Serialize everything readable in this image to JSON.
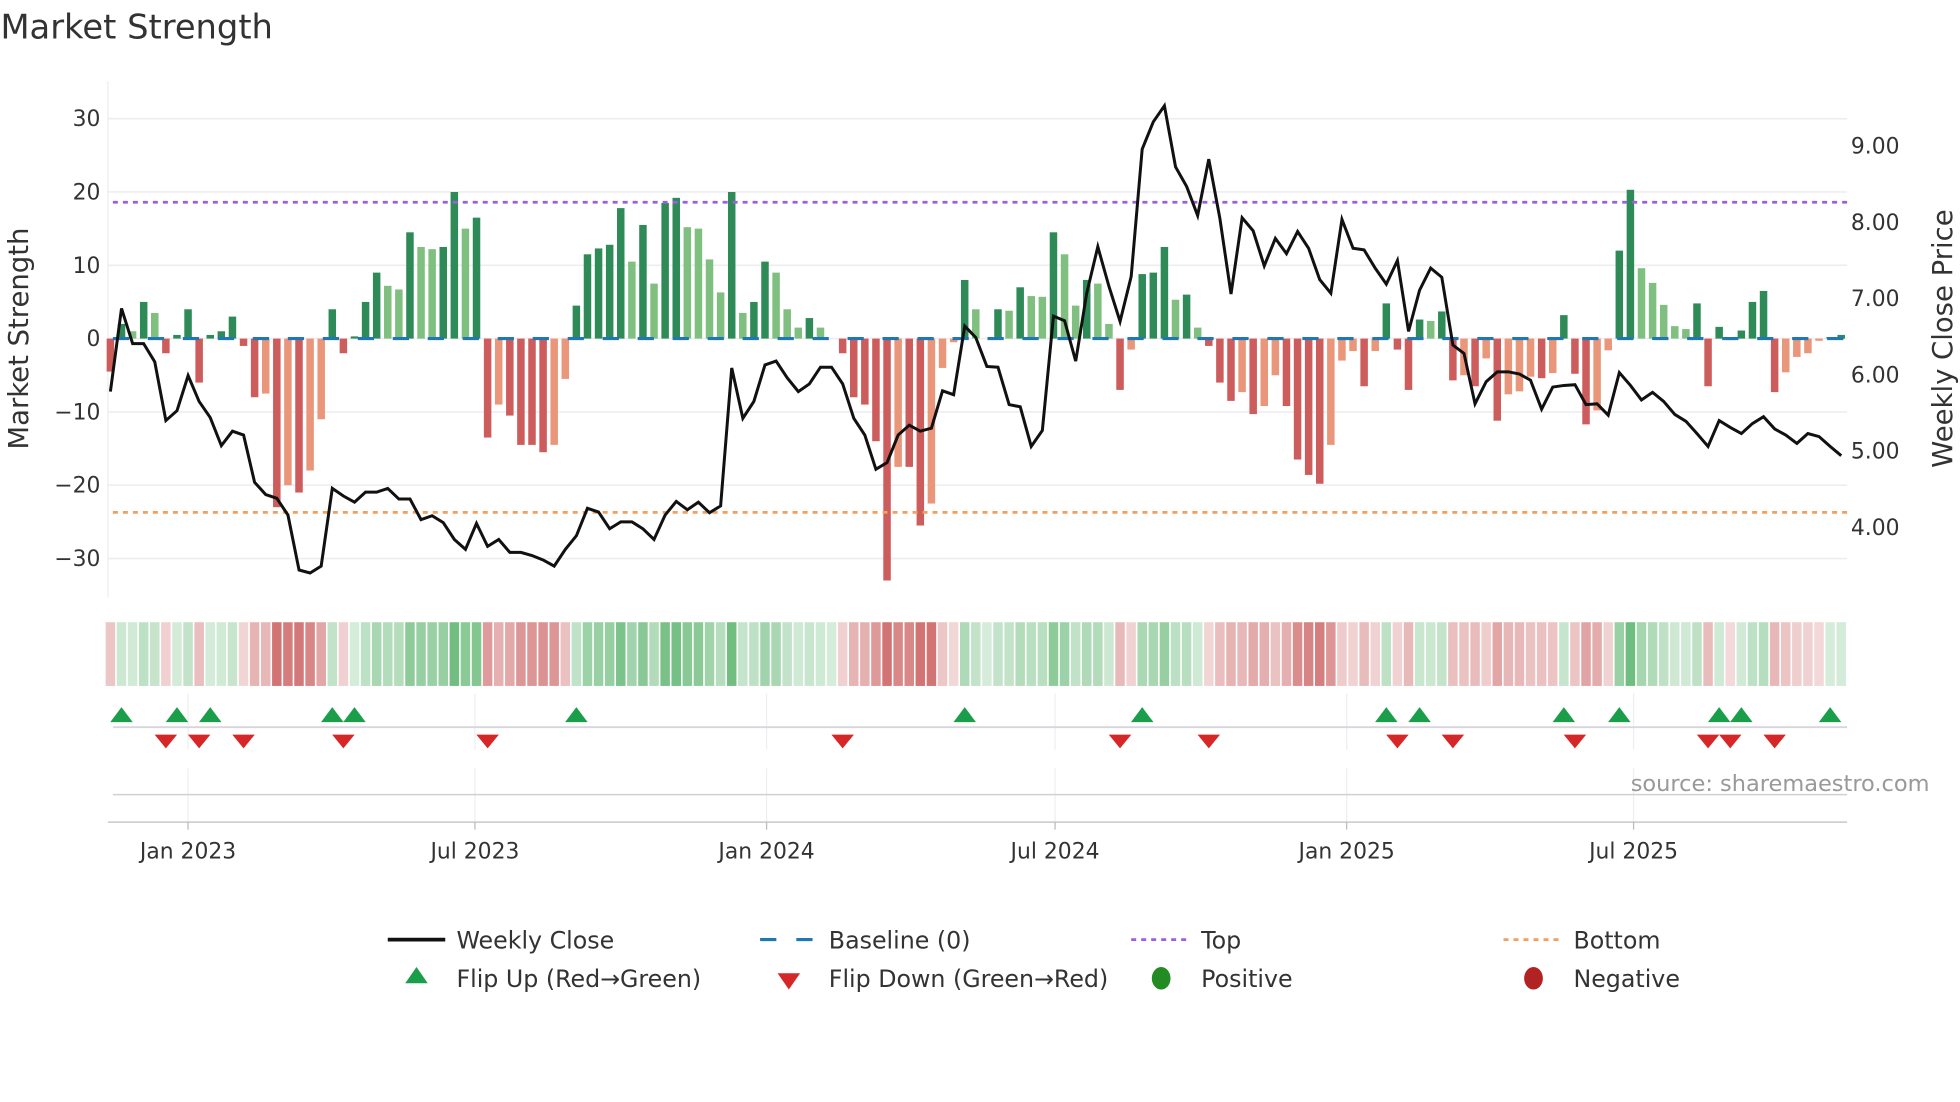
{
  "chart_data": {
    "type": "bar",
    "title": "Market Strength",
    "ylabel": "Market Strength",
    "ylabel_right": "Weekly Close Price",
    "ylim": [
      -35,
      35
    ],
    "ylim_right": [
      3.15,
      9.95
    ],
    "yticks": [
      "30",
      "20",
      "10",
      "0",
      "−10",
      "−20",
      "−30"
    ],
    "ytick_values": [
      30,
      20,
      10,
      0,
      -10,
      -20,
      -30
    ],
    "yticks_right": [
      "9.00",
      "8.00",
      "7.00",
      "6.00",
      "5.00",
      "4.00"
    ],
    "ytick_right_values": [
      9,
      8,
      7,
      6,
      5,
      4
    ],
    "x_start_date": "2022-11-13",
    "x_interval_days": 7,
    "xticks": [
      {
        "date": "2023-01-01",
        "label": "Jan 2023"
      },
      {
        "date": "2023-07-01",
        "label": "Jul 2023"
      },
      {
        "date": "2024-01-01",
        "label": "Jan 2024"
      },
      {
        "date": "2024-07-01",
        "label": "Jul 2024"
      },
      {
        "date": "2025-01-01",
        "label": "Jan 2025"
      },
      {
        "date": "2025-07-01",
        "label": "Jul 2025"
      }
    ],
    "grid": true,
    "top_level": 18.6,
    "bottom_level": -23.7,
    "baseline": 0,
    "strength": [
      -4.5,
      2,
      1,
      5,
      3.5,
      -2,
      0.5,
      4,
      -6,
      0.5,
      1,
      3,
      -1,
      -8,
      -7.5,
      -23,
      -20,
      -21,
      -18,
      -11,
      4,
      -2,
      0.3,
      5,
      9,
      7.2,
      6.7,
      14.5,
      12.5,
      12.2,
      12.5,
      20,
      15,
      16.5,
      -13.5,
      -9,
      -10.5,
      -14.5,
      -14.5,
      -15.5,
      -14.5,
      -5.5,
      4.5,
      11.5,
      12.3,
      12.8,
      17.8,
      10.5,
      15.5,
      7.5,
      18.5,
      19.2,
      15.2,
      15,
      10.8,
      6.3,
      20,
      3.5,
      5,
      10.5,
      9,
      4,
      1.5,
      2.8,
      1.5,
      0,
      -2,
      -8,
      -9,
      -14,
      -33,
      -17.5,
      -17.5,
      -25.5,
      -22.5,
      -4,
      -0.5,
      8,
      4,
      0,
      4,
      3.8,
      7,
      5.8,
      5.7,
      14.5,
      11.5,
      4.5,
      8,
      7.5,
      2,
      -7,
      -1.5,
      8.8,
      9,
      12.5,
      5.3,
      6,
      1.5,
      -1,
      -6,
      -8.5,
      -7.3,
      -10.3,
      -9.2,
      -5,
      -9.2,
      -16.5,
      -18.6,
      -19.8,
      -14.5,
      -3,
      -1.7,
      -6.5,
      -1.7,
      4.8,
      -1.5,
      -7,
      2.6,
      2.4,
      3.7,
      -5.7,
      -5,
      -6.5,
      -2.7,
      -11.2,
      -7.6,
      -7.2,
      -5.2,
      -5.4,
      -4.7,
      3.2,
      -4.8,
      -11.7,
      -9.8,
      -1.6,
      12,
      20.3,
      9.6,
      7.6,
      4.6,
      1.7,
      1.3,
      4.8,
      -6.5,
      1.6,
      -0.2,
      1.1,
      5,
      6.5,
      -7.3,
      -4.6,
      -2.5,
      -2,
      -0.3,
      0.2,
      0.5
    ],
    "weekly_close": [
      5.78,
      6.87,
      6.41,
      6.41,
      6.17,
      5.4,
      5.53,
      5.99,
      5.65,
      5.44,
      5.07,
      5.26,
      5.21,
      4.59,
      4.43,
      4.38,
      4.16,
      3.44,
      3.4,
      3.49,
      4.51,
      4.41,
      4.33,
      4.46,
      4.46,
      4.51,
      4.37,
      4.37,
      4.1,
      4.15,
      4.06,
      3.84,
      3.71,
      4.05,
      3.75,
      3.84,
      3.67,
      3.67,
      3.63,
      3.57,
      3.49,
      3.71,
      3.89,
      4.25,
      4.2,
      3.98,
      4.07,
      4.07,
      3.98,
      3.84,
      4.16,
      4.34,
      4.23,
      4.33,
      4.19,
      4.28,
      6.09,
      5.43,
      5.65,
      6.13,
      6.18,
      5.96,
      5.78,
      5.88,
      6.1,
      6.1,
      5.88,
      5.43,
      5.21,
      4.76,
      4.85,
      5.21,
      5.34,
      5.26,
      5.3,
      5.79,
      5.74,
      6.64,
      6.49,
      6.11,
      6.1,
      5.61,
      5.58,
      5.06,
      5.27,
      6.77,
      6.71,
      6.18,
      7.07,
      7.68,
      7.16,
      6.7,
      7.29,
      8.96,
      9.32,
      9.53,
      8.73,
      8.47,
      8.09,
      8.83,
      8.05,
      7.06,
      8.06,
      7.89,
      7.43,
      7.79,
      7.59,
      7.88,
      7.66,
      7.25,
      7.07,
      8.04,
      7.66,
      7.64,
      7.4,
      7.19,
      7.5,
      6.57,
      7.11,
      7.4,
      7.28,
      6.39,
      6.28,
      5.62,
      5.91,
      6.04,
      6.04,
      6.01,
      5.93,
      5.55,
      5.84,
      5.86,
      5.87,
      5.61,
      5.62,
      5.47,
      6.03,
      5.86,
      5.67,
      5.77,
      5.65,
      5.48,
      5.39,
      5.23,
      5.06,
      5.4,
      5.31,
      5.23,
      5.36,
      5.45,
      5.29,
      5.21,
      5.1,
      5.23,
      5.19,
      5.06,
      4.94
    ],
    "flip_up_weeks": [
      1,
      6,
      9,
      20,
      22,
      42,
      77,
      93,
      115,
      118,
      131,
      136,
      145,
      147,
      155
    ],
    "flip_down_weeks": [
      5,
      8,
      12,
      21,
      34,
      66,
      91,
      99,
      116,
      121,
      132,
      144,
      146,
      150
    ],
    "legend_position": "bottom",
    "legend": [
      {
        "label": "Weekly Close"
      },
      {
        "label": "Baseline (0)"
      },
      {
        "label": "Top"
      },
      {
        "label": "Bottom"
      },
      {
        "label": "Flip Up (Red→Green)"
      },
      {
        "label": "Flip Down (Green→Red)"
      },
      {
        "label": "Positive"
      },
      {
        "label": "Negative"
      }
    ],
    "source": "source: sharemaestro.com"
  },
  "colors": {
    "strong_positive": "#2e8b57",
    "fading_positive": "#7fbf7f",
    "strong_negative": "#cd5c5c",
    "fading_negative": "#e9967a",
    "close_line": "#111111",
    "baseline": "#1f77b4",
    "top": "#9b5fe0",
    "bottom": "#f0a060",
    "flip_up": "#1a9e4a",
    "flip_down": "#d62728",
    "positive": "#228b22",
    "negative": "#b22222"
  }
}
